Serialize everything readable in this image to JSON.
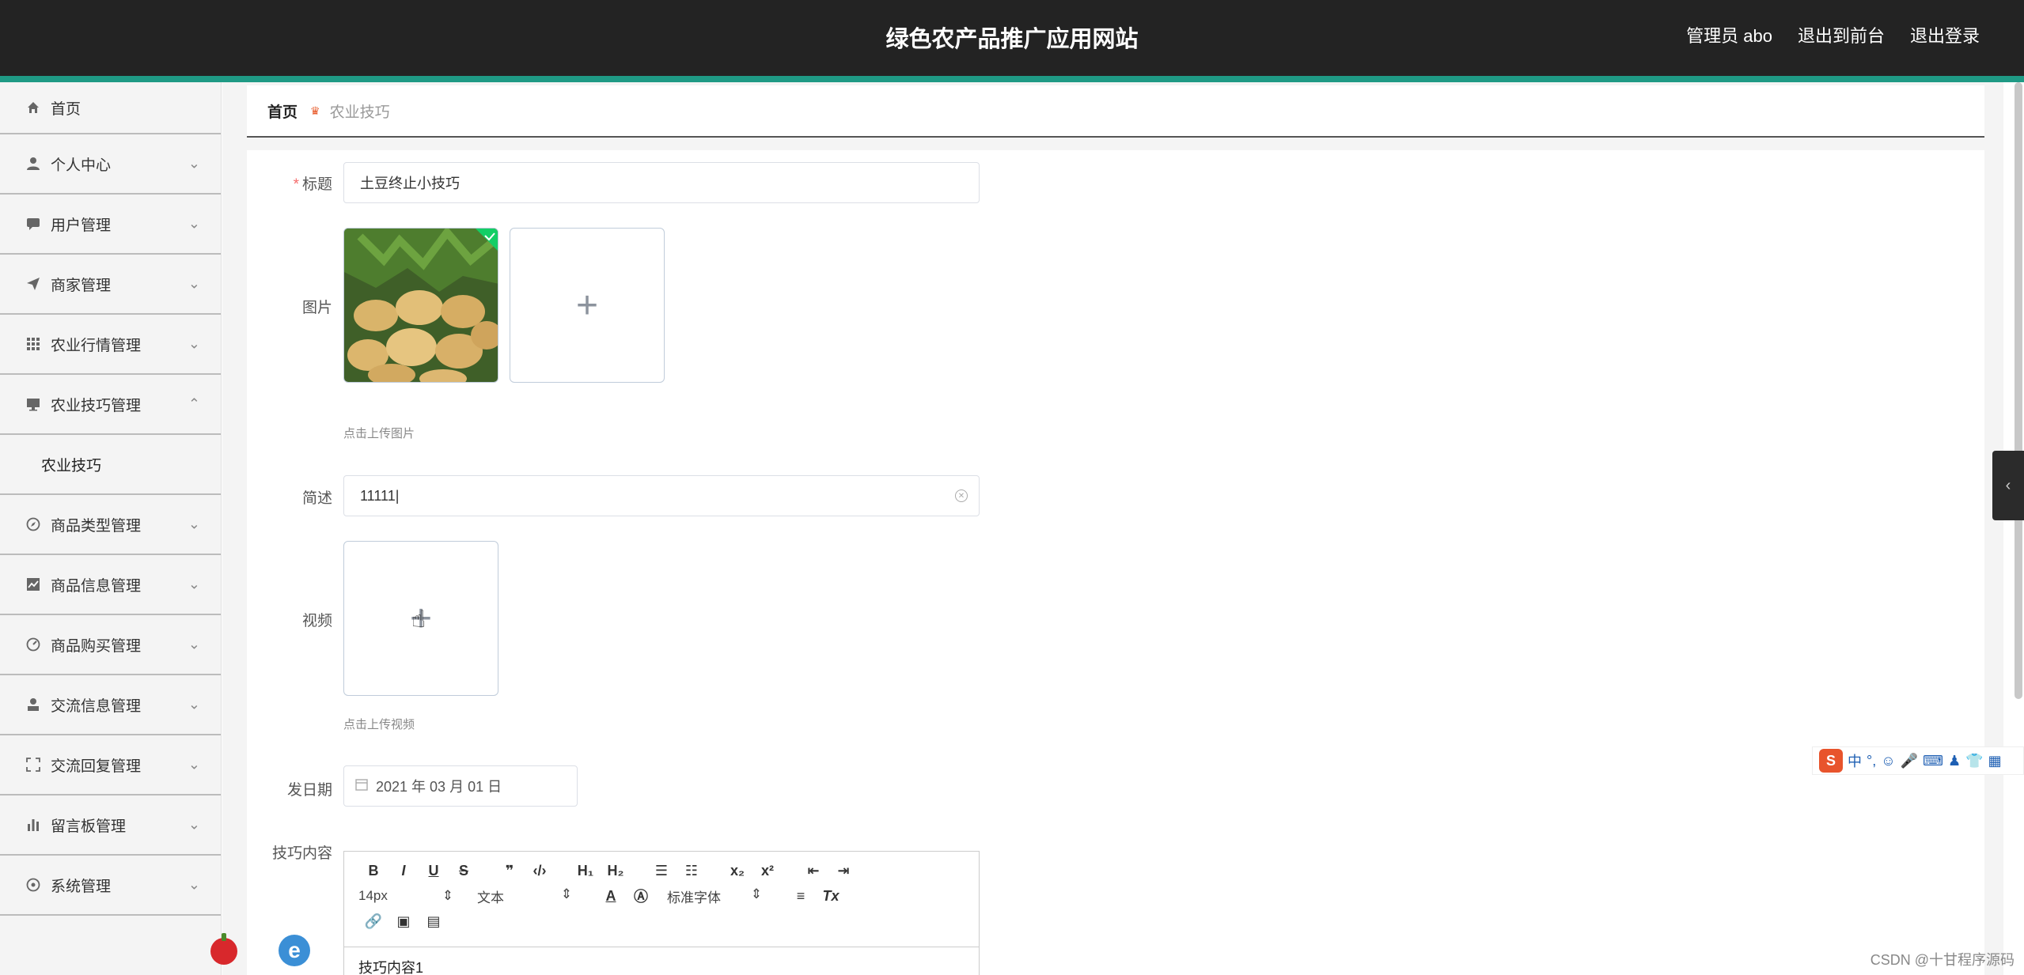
{
  "header": {
    "title": "绿色农产品推广应用网站",
    "links": [
      "管理员 abo",
      "退出到前台",
      "退出登录"
    ]
  },
  "sidebar": {
    "items": [
      {
        "label": "首页",
        "icon": "home-icon"
      },
      {
        "label": "个人中心",
        "icon": "user-icon"
      },
      {
        "label": "用户管理",
        "icon": "chat-icon"
      },
      {
        "label": "商家管理",
        "icon": "send-icon"
      },
      {
        "label": "农业行情管理",
        "icon": "grid-icon"
      },
      {
        "label": "农业技巧管理",
        "icon": "monitor-icon",
        "expanded": true
      },
      {
        "label": "商品类型管理",
        "icon": "compass-icon"
      },
      {
        "label": "商品信息管理",
        "icon": "chart-icon"
      },
      {
        "label": "商品购买管理",
        "icon": "speed-icon"
      },
      {
        "label": "交流信息管理",
        "icon": "person-icon"
      },
      {
        "label": "交流回复管理",
        "icon": "fullscreen-icon"
      },
      {
        "label": "留言板管理",
        "icon": "bars-icon"
      },
      {
        "label": "系统管理",
        "icon": "settings-icon"
      }
    ],
    "sub_item": "农业技巧"
  },
  "breadcrumb": {
    "home": "首页",
    "current": "农业技巧"
  },
  "form": {
    "title_label": "标题",
    "title_value": "土豆终止小技巧",
    "image_label": "图片",
    "image_hint": "点击上传图片",
    "summary_label": "简述",
    "summary_value": "11111",
    "video_label": "视频",
    "video_hint": "点击上传视频",
    "date_label": "发日期",
    "date_value": "2021 年 03 月 01 日",
    "content_label": "技巧内容",
    "content_value": "技巧内容1"
  },
  "editor": {
    "font_size": "14px",
    "text_style": "文本",
    "font_family": "标准字体"
  },
  "ime": {
    "mode": "中"
  },
  "watermark": "CSDN @十甘程序源码",
  "colors": {
    "header_bg": "#232323",
    "accent": "#1f9a85",
    "required": "#f56c6c"
  }
}
